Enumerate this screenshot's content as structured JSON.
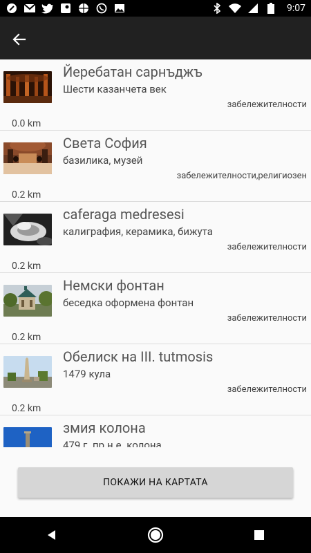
{
  "status_bar": {
    "time": "9:07",
    "left_icons": [
      "app-icon",
      "gmail-icon",
      "twitter-icon",
      "maps-icon",
      "basketball-icon",
      "whatsapp-icon",
      "photos-icon"
    ],
    "right_icons": [
      "bluetooth-icon",
      "wifi-icon",
      "signal-icon",
      "battery-icon"
    ]
  },
  "toolbar": {
    "back_icon": "arrow-left-icon"
  },
  "places": [
    {
      "title": "Йеребатан сарнъджъ",
      "subtitle": "Шести казанчета век",
      "category": "забележителности",
      "distance": "0.0 km",
      "thumb": "cistern"
    },
    {
      "title": "Света София",
      "subtitle": "базилика, музей",
      "category": "забележителности,религиозен",
      "distance": "0.2 km",
      "thumb": "hagia-sophia"
    },
    {
      "title": "caferaga medresesi",
      "subtitle": "калиграфия, керамика, бижута",
      "category": "забележителности",
      "distance": "0.2 km",
      "thumb": "pottery"
    },
    {
      "title": "Немски фонтан",
      "subtitle": "беседка оформена фонтан",
      "category": "забележителности",
      "distance": "0.2 km",
      "thumb": "fountain"
    },
    {
      "title": "Обелиск на III. tutmosis",
      "subtitle": "1479 кула",
      "category": "забележителности",
      "distance": "0.2 km",
      "thumb": "obelisk"
    },
    {
      "title": "змия колона",
      "subtitle": "479 г. пр.н.е. колона",
      "category": "",
      "distance": "",
      "thumb": "column"
    }
  ],
  "map_button": {
    "label": "ПОКАЖИ НА КАРТАТА"
  },
  "nav_bar": {
    "icons": [
      "back-triangle-icon",
      "home-circle-icon",
      "recents-square-icon"
    ]
  }
}
